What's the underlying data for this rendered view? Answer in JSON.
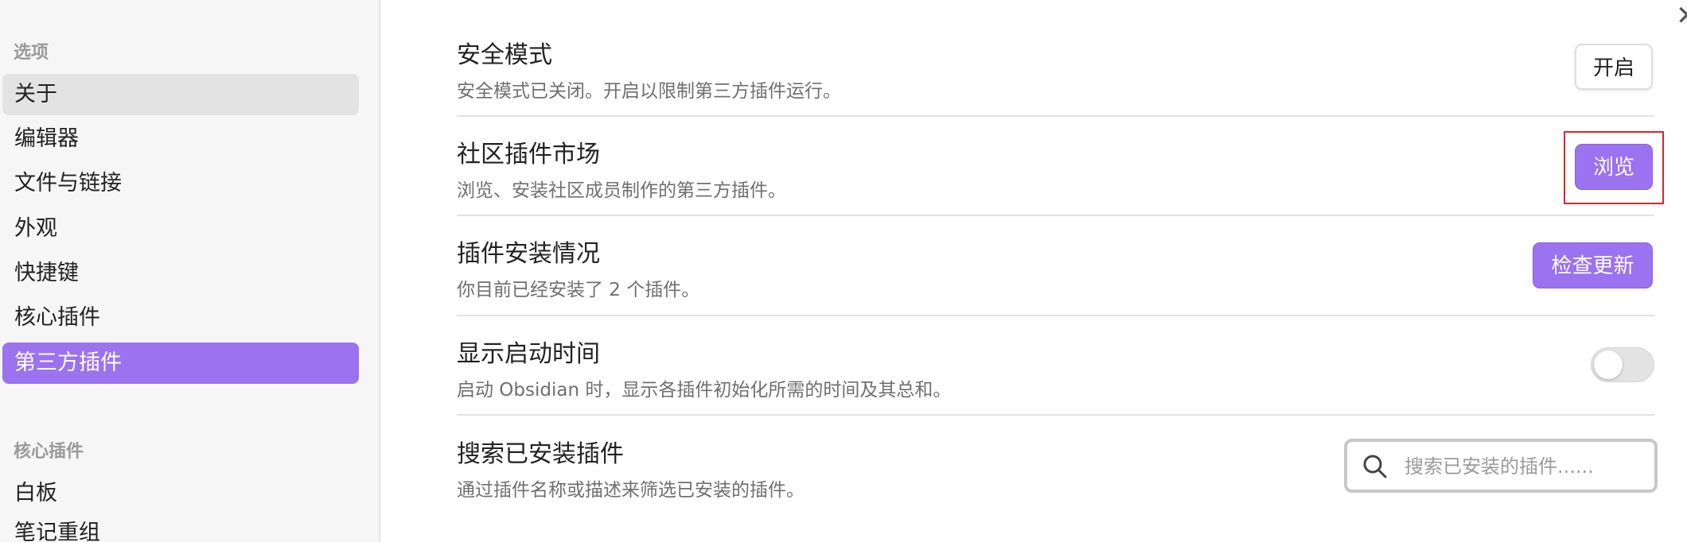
{
  "sidebar": {
    "section_options": "选项",
    "items": [
      {
        "label": "关于"
      },
      {
        "label": "编辑器"
      },
      {
        "label": "文件与链接"
      },
      {
        "label": "外观"
      },
      {
        "label": "快捷键"
      },
      {
        "label": "核心插件"
      },
      {
        "label": "第三方插件"
      }
    ],
    "section_core_plugins": "核心插件",
    "core_items": [
      {
        "label": "白板"
      },
      {
        "label": "笔记重组"
      }
    ]
  },
  "settings": {
    "safe_mode": {
      "title": "安全模式",
      "desc": "安全模式已关闭。开启以限制第三方插件运行。",
      "button": "开启"
    },
    "community_market": {
      "title": "社区插件市场",
      "desc": "浏览、安装社区成员制作的第三方插件。",
      "button": "浏览"
    },
    "installed_status": {
      "title": "插件安装情况",
      "desc": "你目前已经安装了 2 个插件。",
      "button": "检查更新"
    },
    "startup_time": {
      "title": "显示启动时间",
      "desc": "启动 Obsidian 时，显示各插件初始化所需的时间及其总和。",
      "toggle_on": false
    },
    "search_installed": {
      "title": "搜索已安装插件",
      "desc": "通过插件名称或描述来筛选已安装的插件。",
      "placeholder": "搜索已安装的插件......",
      "value": ""
    }
  },
  "colors": {
    "accent": "#9b72ef",
    "sidebar_bg": "#f6f6f6",
    "highlight": "#d9262f"
  },
  "icons": {
    "close": "close-icon",
    "search": "search-icon"
  }
}
